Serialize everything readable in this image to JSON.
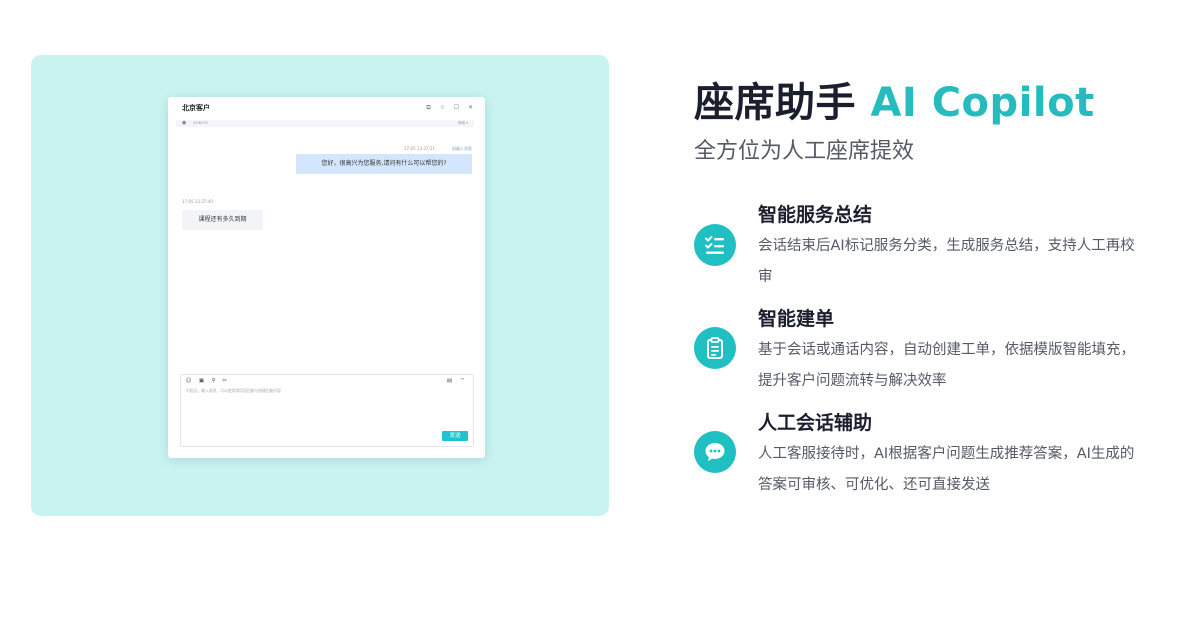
{
  "left_demo": {
    "window_title": "北京客户",
    "controls": [
      "⧉",
      "☆",
      "☐",
      "✕"
    ],
    "subbar_left": "5/98076",
    "subbar_right": "修改 ▾",
    "messages": [
      {
        "role": "agent",
        "time": "17-05 13:37:21",
        "tag": "机器人消息",
        "text": "您好，很高兴为您服务,请问有什么可以帮您的?"
      },
      {
        "role": "customer",
        "time": "17-05 13:37:40",
        "text": "课程还有多久到期"
      }
    ],
    "composer_placeholder": "不超过，输入消息，可以使用常用语回复与快捷回复内容",
    "send_label": "发送"
  },
  "hero": {
    "title_main": "座席助手",
    "title_accent": "AI Copilot",
    "subtitle": "全方位为人工座席提效",
    "accent_color": "#26bcbf"
  },
  "features": [
    {
      "icon": "checklist-icon",
      "name": "智能服务总结",
      "desc": "会话结束后AI标记服务分类，生成服务总结，支持人工再校审"
    },
    {
      "icon": "clipboard-icon",
      "name": "智能建单",
      "desc": "基于会话或通话内容，自动创建工单，依据模版智能填充，提升客户问题流转与解决效率"
    },
    {
      "icon": "chat-bubble-icon",
      "name": "人工会话辅助",
      "desc": "人工客服接待时，AI根据客户问题生成推荐答案，AI生成的答案可审核、可优化、还可直接发送"
    }
  ]
}
